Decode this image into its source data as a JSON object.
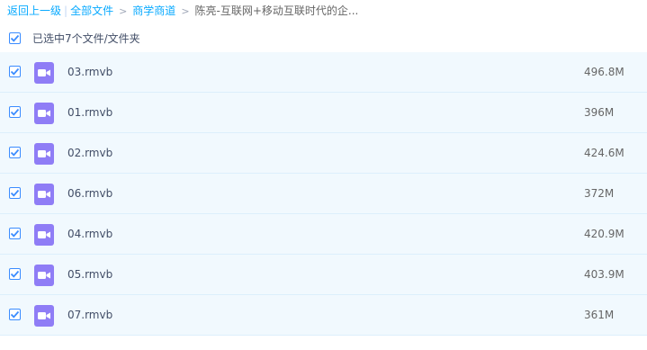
{
  "breadcrumb": {
    "back": "返回上一级",
    "separator": "|",
    "items": [
      "全部文件",
      "商学商道"
    ],
    "current": "陈亮-互联网+移动互联时代的企..."
  },
  "selection": {
    "text": "已选中7个文件/文件夹",
    "checked": true
  },
  "files": [
    {
      "name": "03.rmvb",
      "size": "496.8M",
      "checked": true,
      "icon": "video-file-icon"
    },
    {
      "name": "01.rmvb",
      "size": "396M",
      "checked": true,
      "icon": "video-file-icon"
    },
    {
      "name": "02.rmvb",
      "size": "424.6M",
      "checked": true,
      "icon": "video-file-icon"
    },
    {
      "name": "06.rmvb",
      "size": "372M",
      "checked": true,
      "icon": "video-file-icon"
    },
    {
      "name": "04.rmvb",
      "size": "420.9M",
      "checked": true,
      "icon": "video-file-icon"
    },
    {
      "name": "05.rmvb",
      "size": "403.9M",
      "checked": true,
      "icon": "video-file-icon"
    },
    {
      "name": "07.rmvb",
      "size": "361M",
      "checked": true,
      "icon": "video-file-icon"
    }
  ],
  "colors": {
    "accent": "#09aaff",
    "checkbox": "#3b8cff",
    "row_bg": "#f1f9fe",
    "video_icon": "#8f7df6"
  }
}
